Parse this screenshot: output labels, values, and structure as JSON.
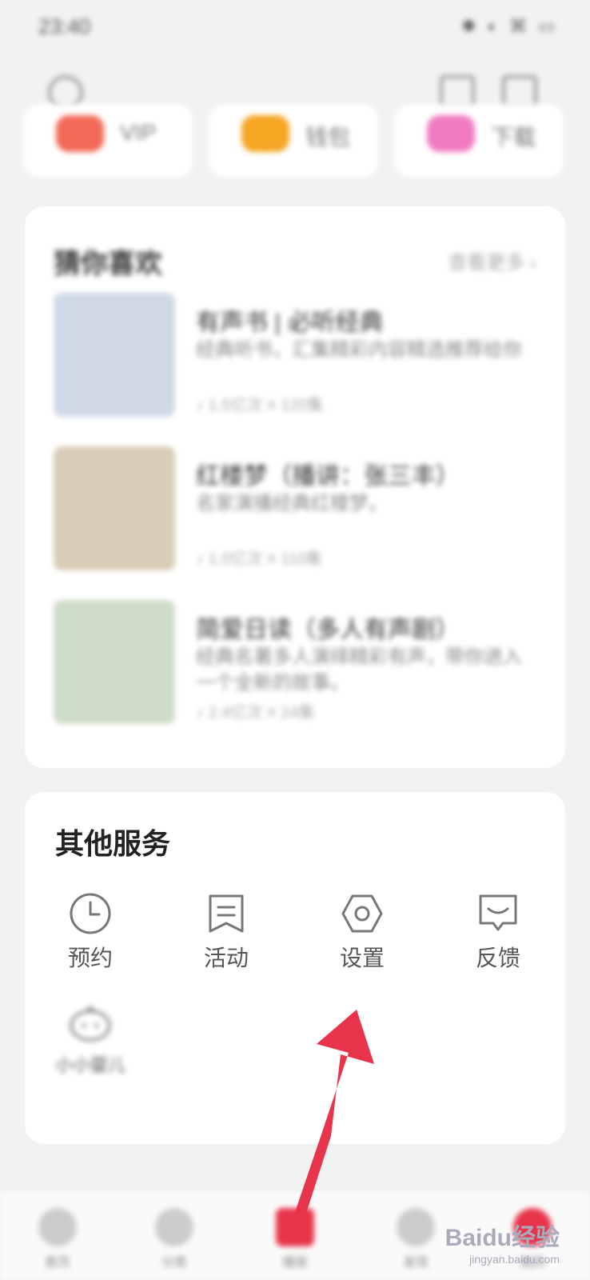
{
  "status_bar": {
    "time": "23:40",
    "icons": "✱ ◐ ⌘ ▭"
  },
  "shortcuts": [
    {
      "label": "VIP",
      "color": "#f26a57"
    },
    {
      "label": "钱包",
      "color": "#f5a623"
    },
    {
      "label": "下载",
      "color": "#f07ac0"
    }
  ],
  "recommend": {
    "title": "猜你喜欢",
    "more": "查看更多 ›",
    "books": [
      {
        "title": "有声书 | 必听经典",
        "desc": "经典听书，汇集精彩内容精选推荐给你",
        "meta": "♪ 1.5亿次  ≡ 120集",
        "cover": "#cfd9e6"
      },
      {
        "title": "红楼梦（播讲：张三丰）",
        "desc": "名家演播经典红楼梦。",
        "meta": "♪ 1.0亿次  ≡ 110集",
        "cover": "#d9cdb8"
      },
      {
        "title": "简爱日读（多人有声剧）",
        "desc": "经典名著多人演绎精彩有声，带你进入一个全新的故事。",
        "meta": "♪ 2.4亿次  ≡ 24集",
        "cover": "#cfdcc9"
      }
    ]
  },
  "services": {
    "title": "其他服务",
    "items": [
      {
        "label": "预约",
        "icon": "clock-icon"
      },
      {
        "label": "活动",
        "icon": "bookmark-icon"
      },
      {
        "label": "设置",
        "icon": "settings-icon"
      },
      {
        "label": "反馈",
        "icon": "feedback-icon"
      },
      {
        "label": "小小婴儿",
        "icon": "baby-icon"
      }
    ]
  },
  "tabbar": [
    {
      "label": "首页"
    },
    {
      "label": "分类"
    },
    {
      "label": "播放"
    },
    {
      "label": "发现"
    },
    {
      "label": "我的"
    }
  ],
  "watermark": {
    "brand": "Baidu经验",
    "url": "jingyan.baidu.com"
  },
  "colors": {
    "accent": "#e8344a"
  }
}
